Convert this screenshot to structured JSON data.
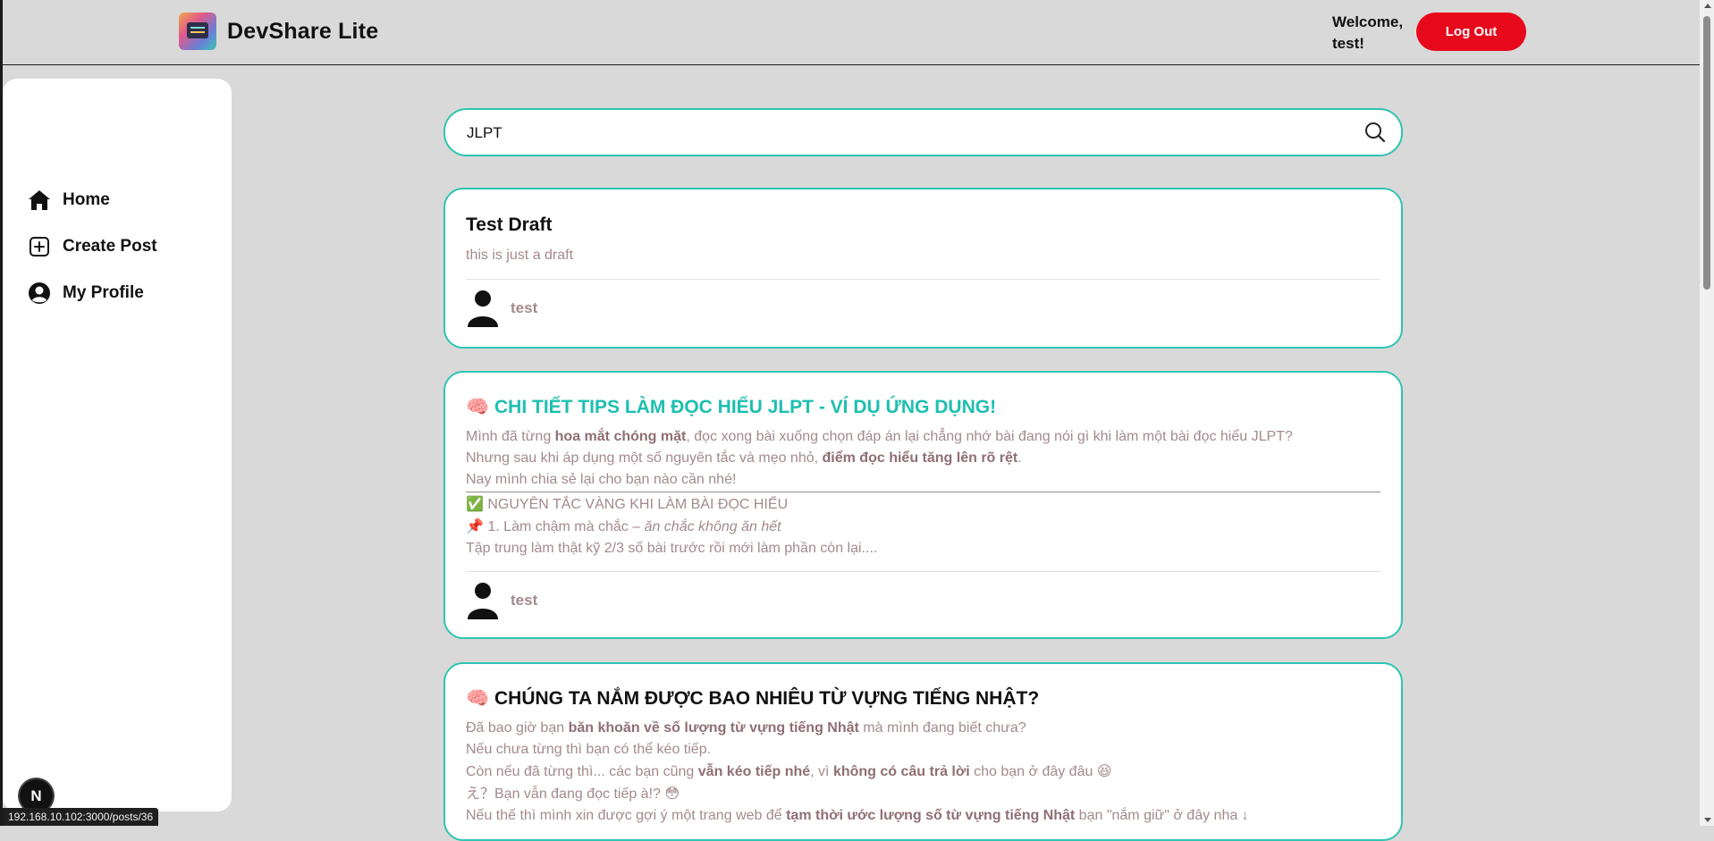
{
  "header": {
    "app_title": "DevShare Lite",
    "welcome_line1": "Welcome,",
    "welcome_line2": "test!",
    "logout_label": "Log Out",
    "logout_color": "#e8081c"
  },
  "sidebar": {
    "items": [
      {
        "label": "Home",
        "icon": "home-icon"
      },
      {
        "label": "Create Post",
        "icon": "plus-square-icon"
      },
      {
        "label": "My Profile",
        "icon": "user-circle-icon"
      }
    ]
  },
  "search": {
    "value": "JLPT",
    "placeholder": "",
    "icon": "search-icon"
  },
  "accent_color": "#2fc4b2",
  "posts": [
    {
      "title": "Test Draft",
      "excerpt": "this is just a draft",
      "author": "test"
    },
    {
      "title_emoji": "🧠",
      "title": "CHI TIẾT TIPS LÀM ĐỌC HIỂU JLPT - VÍ DỤ ỨNG DỤNG!",
      "p1": {
        "t1": "Mình đã từng ",
        "b1": "hoa mắt chóng mặt",
        "t2": ", đọc xong bài xuống chọn đáp án lại chẳng nhớ bài đang nói gì khi làm một bài đọc hiểu JLPT?"
      },
      "p2": {
        "t1": "Nhưng sau khi áp dụng một số nguyên tắc và mẹo nhỏ, ",
        "b1": "điểm đọc hiểu tăng lên rõ rệt",
        "t2": "."
      },
      "p3": "Nay mình chia sẻ lại cho bạn nào cần nhé!",
      "p4": {
        "emoji": "✅",
        "text": "NGUYÊN TẮC VÀNG KHI LÀM BÀI ĐỌC HIỂU"
      },
      "p5": {
        "emoji": "📌",
        "text": "1. Làm chậm mà chắc – ",
        "italic": "ăn chắc không ăn hết"
      },
      "p6": "Tập trung làm thật kỹ 2/3 số bài trước rồi mới làm phần còn lại....",
      "author": "test"
    },
    {
      "title_emoji": "🧠",
      "title": "CHÚNG TA NẮM ĐƯỢC BAO NHIÊU TỪ VỰNG TIẾNG NHẬT?",
      "p1": {
        "t1": "Đã bao giờ bạn ",
        "b1": "băn khoăn về số lượng từ vựng tiếng Nhật",
        "t2": " mà mình đang biết chưa?"
      },
      "p2": "Nếu chưa từng thì bạn có thể kéo tiếp.",
      "p3": {
        "t1": "Còn nếu đã từng thì... các bạn cũng ",
        "b1": "vẫn kéo tiếp nhé",
        "t2": ", vì ",
        "b2": "không có câu trả lời",
        "t3": " cho bạn ở đây đâu ",
        "emoji": "😆"
      },
      "p4": {
        "text": "え？Bạn vẫn đang đọc tiếp à!? ",
        "emoji": "😳"
      },
      "p5": {
        "t1": "Nếu thế thì mình xin được gợi ý một trang web để ",
        "b1": "tạm thời ước lượng số từ vựng tiếng Nhật",
        "t2": " bạn \"nắm giữ\" ở đây nha ↓"
      }
    }
  ],
  "status_url": "192.168.10.102:3000/posts/36",
  "next_badge": "N"
}
